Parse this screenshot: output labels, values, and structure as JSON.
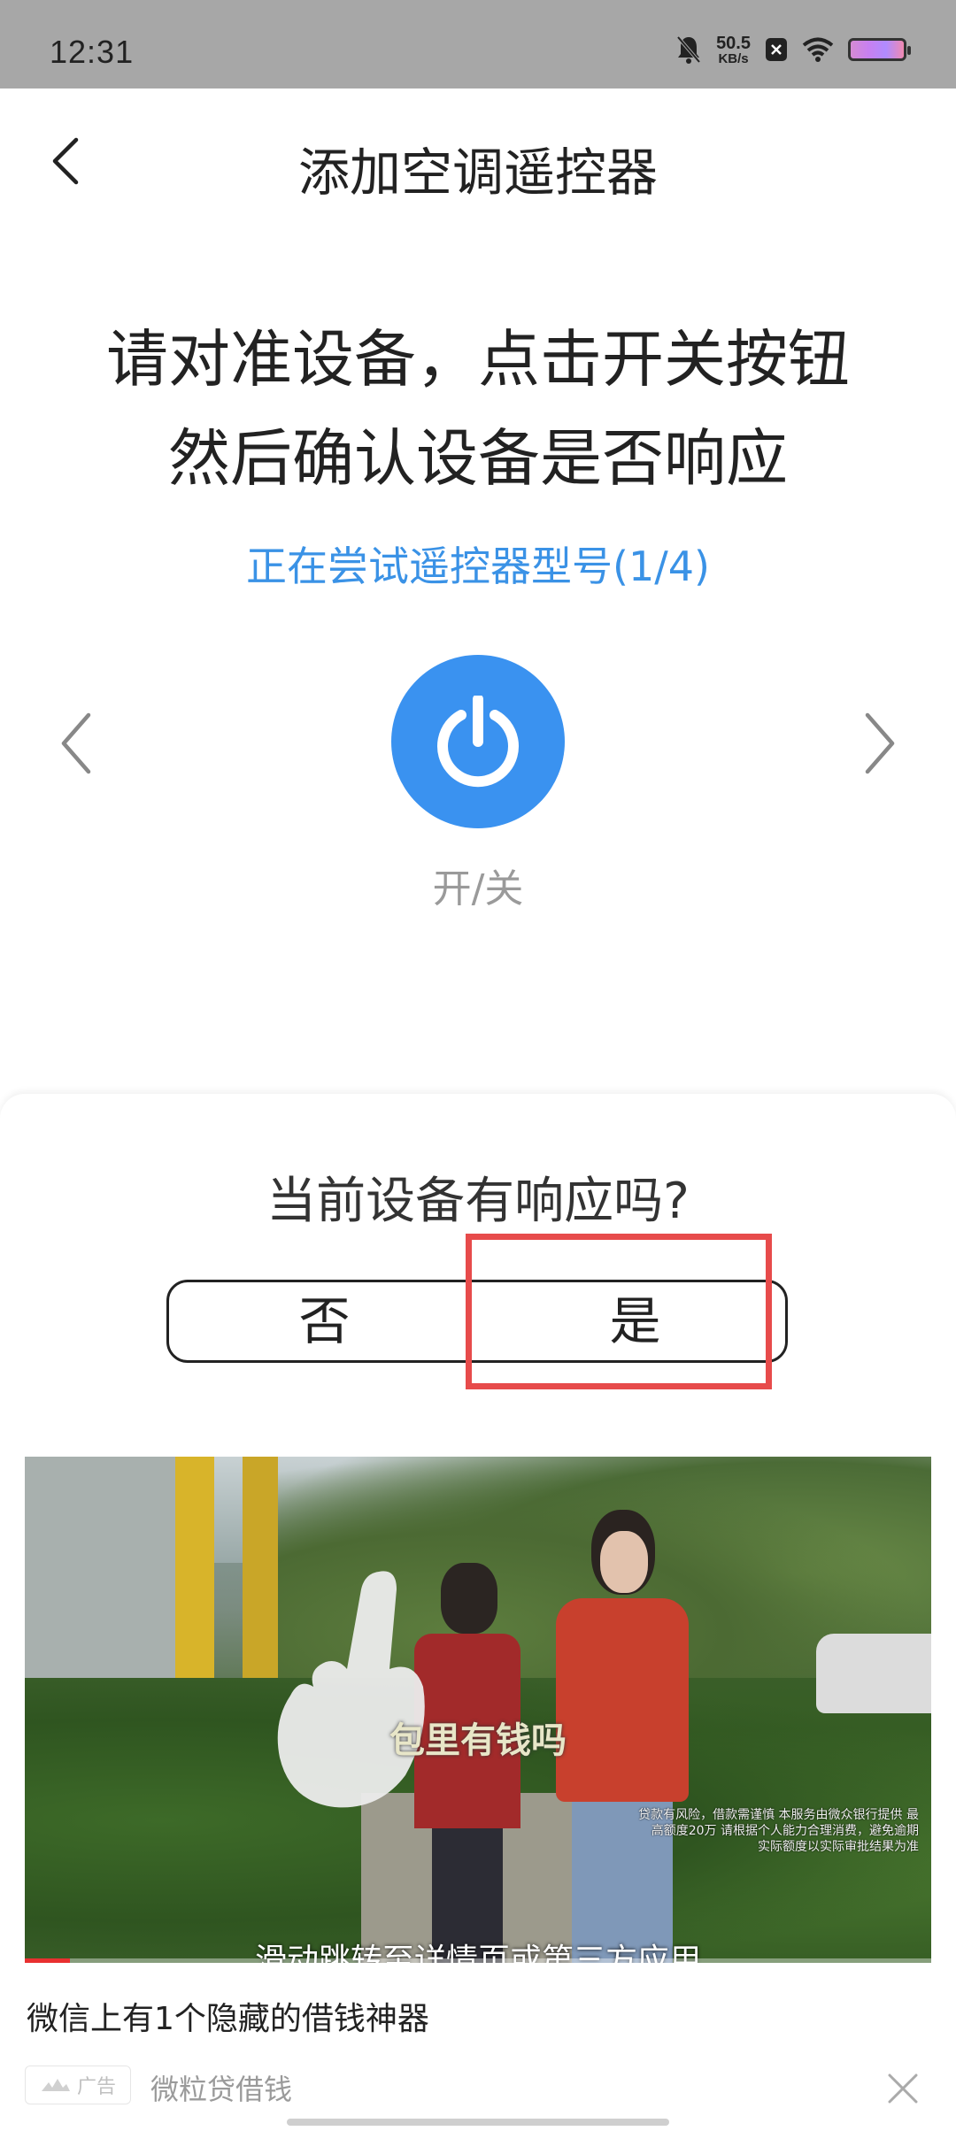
{
  "status_bar": {
    "time": "12:31",
    "net_speed": "50.5",
    "net_unit": "KB/s",
    "icons": [
      "bell-muted-icon",
      "x-app-icon",
      "wifi-icon",
      "battery-icon"
    ]
  },
  "header": {
    "title": "添加空调遥控器",
    "back_icon": "chevron-left-icon"
  },
  "instruction": {
    "line1": "请对准设备，点击开关按钮",
    "line2": "然后确认设备是否响应"
  },
  "model_status": "正在尝试遥控器型号(1/4)",
  "remote": {
    "power_icon": "power-icon",
    "power_label": "开/关",
    "prev_icon": "chevron-left-icon",
    "next_icon": "chevron-right-icon"
  },
  "response_panel": {
    "question": "当前设备有响应吗?",
    "no_label": "否",
    "yes_label": "是"
  },
  "ad": {
    "subtitle": "包里有钱吗",
    "swipe_hint": "滑动跳转至详情页或第三方应用",
    "disclaimer": "贷款有风险，借款需谨慎 本服务由微众银行提供 最高额度20万 请根据个人能力合理消费，避免逾期 实际额度以实际审批结果为准",
    "title": "微信上有1个隐藏的借钱神器",
    "badge_label": "广告",
    "source": "微粒贷借钱",
    "close_icon": "close-icon",
    "progress": 0.05
  },
  "colors": {
    "accent": "#3a92e6",
    "power_button": "#3a92f0",
    "highlight": "#e74b4b",
    "status_bar": "#a7a7a7"
  }
}
